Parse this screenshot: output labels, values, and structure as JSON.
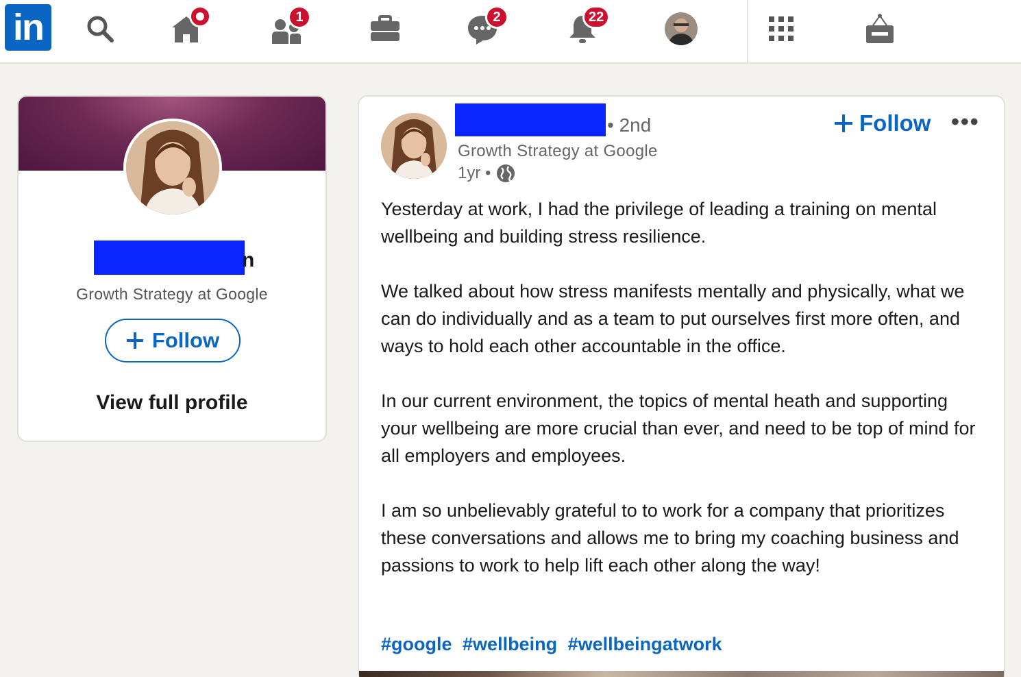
{
  "nav": {
    "logo_text": "in",
    "items": [
      {
        "name": "search-icon"
      },
      {
        "name": "home-icon",
        "badge": "dot"
      },
      {
        "name": "network-icon",
        "badge": "1"
      },
      {
        "name": "jobs-icon"
      },
      {
        "name": "messaging-icon",
        "badge": "2"
      },
      {
        "name": "notifications-icon",
        "badge": "22"
      },
      {
        "name": "me-avatar"
      },
      {
        "name": "apps-grid-icon"
      },
      {
        "name": "advertise-icon"
      }
    ]
  },
  "profile_card": {
    "name_visible_fragment": "n",
    "headline": "Growth Strategy at Google",
    "follow_label": "Follow",
    "view_profile_label": "View full profile"
  },
  "post": {
    "degree": "• 2nd",
    "headline": "Growth Strategy at Google",
    "time": "1yr •",
    "follow_label": "Follow",
    "more_label": "•••",
    "body": [
      "Yesterday at work, I had the privilege of leading a training on mental wellbeing and building stress resilience.",
      "We talked about how stress manifests mentally and physically, what we can do individually and as a team to put ourselves first more often, and ways to hold each other accountable in the office.",
      "In our current environment, the topics of mental heath and supporting your wellbeing are more crucial than ever, and need to be top of mind for all employers and employees.",
      "I am so unbelievably grateful to to work for a company that prioritizes these conversations and allows me to bring my coaching business and passions to work to help lift each other along the way!"
    ],
    "hashtags": [
      "#google",
      "#wellbeing",
      "#wellbeingatwork"
    ]
  },
  "colors": {
    "brand": "#0a66c2",
    "badge": "#cb112d",
    "redaction": "#0a25ff"
  }
}
